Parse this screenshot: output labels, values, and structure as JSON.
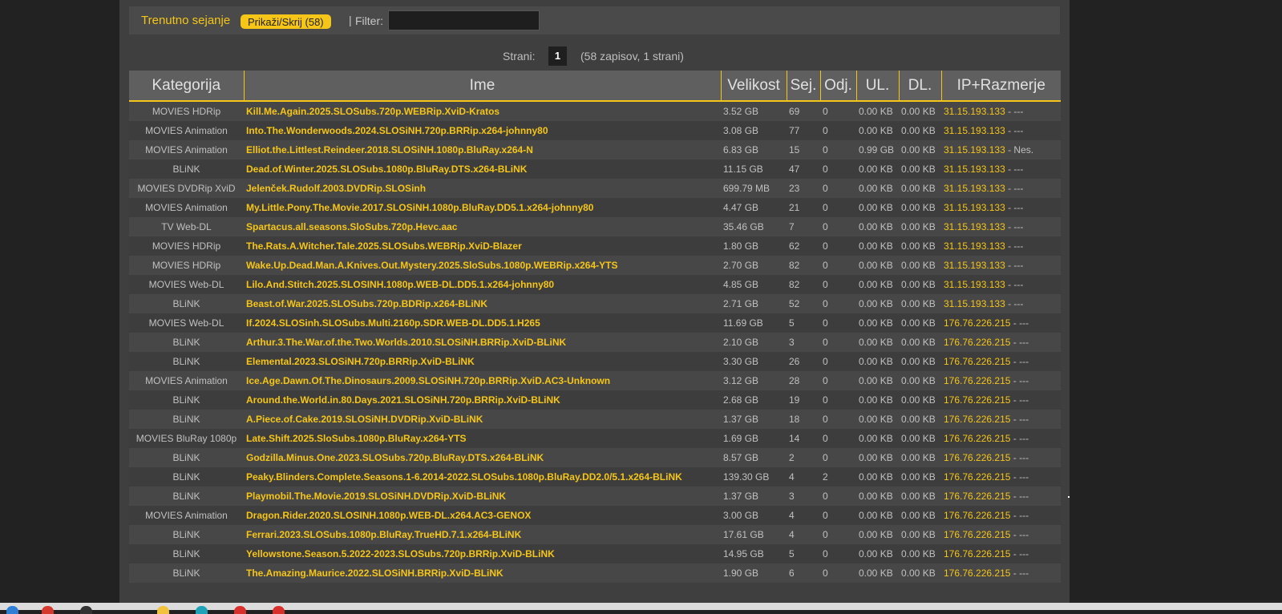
{
  "header": {
    "title": "Trenutno sejanje",
    "toggle_label": "Prikaži/Skrij (58)",
    "separator": "|",
    "filter_label": "Filter:",
    "filter_value": ""
  },
  "pager": {
    "label": "Strani:",
    "current_page": "1",
    "info": "(58 zapisov, 1 strani)"
  },
  "columns": [
    "Kategorija",
    "Ime",
    "Velikost",
    "Sej.",
    "Odj.",
    "UL.",
    "DL.",
    "IP+Razmerje"
  ],
  "rows": [
    {
      "cat": "MOVIES HDRip",
      "name": "Kill.Me.Again.2025.SLOSubs.720p.WEBRip.XviD-Kratos",
      "size": "3.52 GB",
      "seed": "69",
      "leech": "0",
      "ul": "0.00 KB",
      "dl": "0.00 KB",
      "ip": "31.15.193.133",
      "ratio": " - ---"
    },
    {
      "cat": "MOVIES Animation",
      "name": "Into.The.Wonderwoods.2024.SLOSiNH.720p.BRRip.x264-johnny80",
      "size": "3.08 GB",
      "seed": "77",
      "leech": "0",
      "ul": "0.00 KB",
      "dl": "0.00 KB",
      "ip": "31.15.193.133",
      "ratio": " - ---"
    },
    {
      "cat": "MOVIES Animation",
      "name": "Elliot.the.Littlest.Reindeer.2018.SLOSiNH.1080p.BluRay.x264-N",
      "size": "6.83 GB",
      "seed": "15",
      "leech": "0",
      "ul": "0.99 GB",
      "dl": "0.00 KB",
      "ip": "31.15.193.133",
      "ratio": " - Nes."
    },
    {
      "cat": "BLiNK",
      "name": "Dead.of.Winter.2025.SLOSubs.1080p.BluRay.DTS.x264-BLiNK",
      "size": "11.15 GB",
      "seed": "47",
      "leech": "0",
      "ul": "0.00 KB",
      "dl": "0.00 KB",
      "ip": "31.15.193.133",
      "ratio": " - ---"
    },
    {
      "cat": "MOVIES DVDRip XviD",
      "name": "Jelenček.Rudolf.2003.DVDRip.SLOSinh",
      "size": "699.79 MB",
      "seed": "23",
      "leech": "0",
      "ul": "0.00 KB",
      "dl": "0.00 KB",
      "ip": "31.15.193.133",
      "ratio": " - ---"
    },
    {
      "cat": "MOVIES Animation",
      "name": "My.Little.Pony.The.Movie.2017.SLOSiNH.1080p.BluRay.DD5.1.x264-johnny80",
      "size": "4.47 GB",
      "seed": "21",
      "leech": "0",
      "ul": "0.00 KB",
      "dl": "0.00 KB",
      "ip": "31.15.193.133",
      "ratio": " - ---"
    },
    {
      "cat": "TV Web-DL",
      "name": "Spartacus.all.seasons.SloSubs.720p.Hevc.aac",
      "size": "35.46 GB",
      "seed": "7",
      "leech": "0",
      "ul": "0.00 KB",
      "dl": "0.00 KB",
      "ip": "31.15.193.133",
      "ratio": " - ---"
    },
    {
      "cat": "MOVIES HDRip",
      "name": "The.Rats.A.Witcher.Tale.2025.SLOSubs.WEBRip.XviD-Blazer",
      "size": "1.80 GB",
      "seed": "62",
      "leech": "0",
      "ul": "0.00 KB",
      "dl": "0.00 KB",
      "ip": "31.15.193.133",
      "ratio": " - ---"
    },
    {
      "cat": "MOVIES HDRip",
      "name": "Wake.Up.Dead.Man.A.Knives.Out.Mystery.2025.SloSubs.1080p.WEBRip.x264-YTS",
      "size": "2.70 GB",
      "seed": "82",
      "leech": "0",
      "ul": "0.00 KB",
      "dl": "0.00 KB",
      "ip": "31.15.193.133",
      "ratio": " - ---"
    },
    {
      "cat": "MOVIES Web-DL",
      "name": "Lilo.And.Stitch.2025.SLOSINH.1080p.WEB-DL.DD5.1.x264-johnny80",
      "size": "4.85 GB",
      "seed": "82",
      "leech": "0",
      "ul": "0.00 KB",
      "dl": "0.00 KB",
      "ip": "31.15.193.133",
      "ratio": " - ---"
    },
    {
      "cat": "BLiNK",
      "name": "Beast.of.War.2025.SLOSubs.720p.BDRip.x264-BLiNK",
      "size": "2.71 GB",
      "seed": "52",
      "leech": "0",
      "ul": "0.00 KB",
      "dl": "0.00 KB",
      "ip": "31.15.193.133",
      "ratio": " - ---"
    },
    {
      "cat": "MOVIES Web-DL",
      "name": "If.2024.SLOSinh.SLOSubs.Multi.2160p.SDR.WEB-DL.DD5.1.H265",
      "size": "11.69 GB",
      "seed": "5",
      "leech": "0",
      "ul": "0.00 KB",
      "dl": "0.00 KB",
      "ip": "176.76.226.215",
      "ratio": " - ---"
    },
    {
      "cat": "BLiNK",
      "name": "Arthur.3.The.War.of.the.Two.Worlds.2010.SLOSiNH.BRRip.XviD-BLiNK",
      "size": "2.10 GB",
      "seed": "3",
      "leech": "0",
      "ul": "0.00 KB",
      "dl": "0.00 KB",
      "ip": "176.76.226.215",
      "ratio": " - ---"
    },
    {
      "cat": "BLiNK",
      "name": "Elemental.2023.SLOSiNH.720p.BRRip.XviD-BLiNK",
      "size": "3.30 GB",
      "seed": "26",
      "leech": "0",
      "ul": "0.00 KB",
      "dl": "0.00 KB",
      "ip": "176.76.226.215",
      "ratio": " - ---"
    },
    {
      "cat": "MOVIES Animation",
      "name": "Ice.Age.Dawn.Of.The.Dinosaurs.2009.SLOSiNH.720p.BRRip.XviD.AC3-Unknown",
      "size": "3.12 GB",
      "seed": "28",
      "leech": "0",
      "ul": "0.00 KB",
      "dl": "0.00 KB",
      "ip": "176.76.226.215",
      "ratio": " - ---"
    },
    {
      "cat": "BLiNK",
      "name": "Around.the.World.in.80.Days.2021.SLOSiNH.720p.BRRip.XviD-BLiNK",
      "size": "2.68 GB",
      "seed": "19",
      "leech": "0",
      "ul": "0.00 KB",
      "dl": "0.00 KB",
      "ip": "176.76.226.215",
      "ratio": " - ---"
    },
    {
      "cat": "BLiNK",
      "name": "A.Piece.of.Cake.2019.SLOSiNH.DVDRip.XviD-BLiNK",
      "size": "1.37 GB",
      "seed": "18",
      "leech": "0",
      "ul": "0.00 KB",
      "dl": "0.00 KB",
      "ip": "176.76.226.215",
      "ratio": " - ---"
    },
    {
      "cat": "MOVIES BluRay 1080p",
      "name": "Late.Shift.2025.SloSubs.1080p.BluRay.x264-YTS",
      "size": "1.69 GB",
      "seed": "14",
      "leech": "0",
      "ul": "0.00 KB",
      "dl": "0.00 KB",
      "ip": "176.76.226.215",
      "ratio": " - ---"
    },
    {
      "cat": "BLiNK",
      "name": "Godzilla.Minus.One.2023.SLOSubs.720p.BluRay.DTS.x264-BLiNK",
      "size": "8.57 GB",
      "seed": "2",
      "leech": "0",
      "ul": "0.00 KB",
      "dl": "0.00 KB",
      "ip": "176.76.226.215",
      "ratio": " - ---"
    },
    {
      "cat": "BLiNK",
      "name": "Peaky.Blinders.Complete.Seasons.1-6.2014-2022.SLOSubs.1080p.BluRay.DD2.0/5.1.x264-BLiNK",
      "size": "139.30 GB",
      "seed": "4",
      "leech": "2",
      "ul": "0.00 KB",
      "dl": "0.00 KB",
      "ip": "176.76.226.215",
      "ratio": " - ---"
    },
    {
      "cat": "BLiNK",
      "name": "Playmobil.The.Movie.2019.SLOSiNH.DVDRip.XviD-BLiNK",
      "size": "1.37 GB",
      "seed": "3",
      "leech": "0",
      "ul": "0.00 KB",
      "dl": "0.00 KB",
      "ip": "176.76.226.215",
      "ratio": " - ---"
    },
    {
      "cat": "MOVIES Animation",
      "name": "Dragon.Rider.2020.SLOSINH.1080p.WEB-DL.x264.AC3-GENOX",
      "size": "3.00 GB",
      "seed": "4",
      "leech": "0",
      "ul": "0.00 KB",
      "dl": "0.00 KB",
      "ip": "176.76.226.215",
      "ratio": " - ---"
    },
    {
      "cat": "BLiNK",
      "name": "Ferrari.2023.SLOSubs.1080p.BluRay.TrueHD.7.1.x264-BLiNK",
      "size": "17.61 GB",
      "seed": "4",
      "leech": "0",
      "ul": "0.00 KB",
      "dl": "0.00 KB",
      "ip": "176.76.226.215",
      "ratio": " - ---"
    },
    {
      "cat": "BLiNK",
      "name": "Yellowstone.Season.5.2022-2023.SLOSubs.720p.BRRip.XviD-BLiNK",
      "size": "14.95 GB",
      "seed": "5",
      "leech": "0",
      "ul": "0.00 KB",
      "dl": "0.00 KB",
      "ip": "176.76.226.215",
      "ratio": " - ---"
    },
    {
      "cat": "BLiNK",
      "name": "The.Amazing.Maurice.2022.SLOSiNH.BRRip.XviD-BLiNK",
      "size": "1.90 GB",
      "seed": "6",
      "leech": "0",
      "ul": "0.00 KB",
      "dl": "0.00 KB",
      "ip": "176.76.226.215",
      "ratio": " - ---"
    }
  ],
  "taskbar": {
    "icons": [
      {
        "name": "app-icon-blue",
        "color": "#2f7fd6"
      },
      {
        "name": "app-icon-red",
        "color": "#d63a2f"
      },
      {
        "name": "app-icon-dark",
        "color": "#333333"
      },
      {
        "name": "app-icon-yellow",
        "color": "#f2c33a"
      },
      {
        "name": "app-icon-teal",
        "color": "#1fa3b8"
      },
      {
        "name": "app-icon-red-2",
        "color": "#d9302c"
      },
      {
        "name": "app-icon-red-3",
        "color": "#d9302c"
      }
    ]
  }
}
